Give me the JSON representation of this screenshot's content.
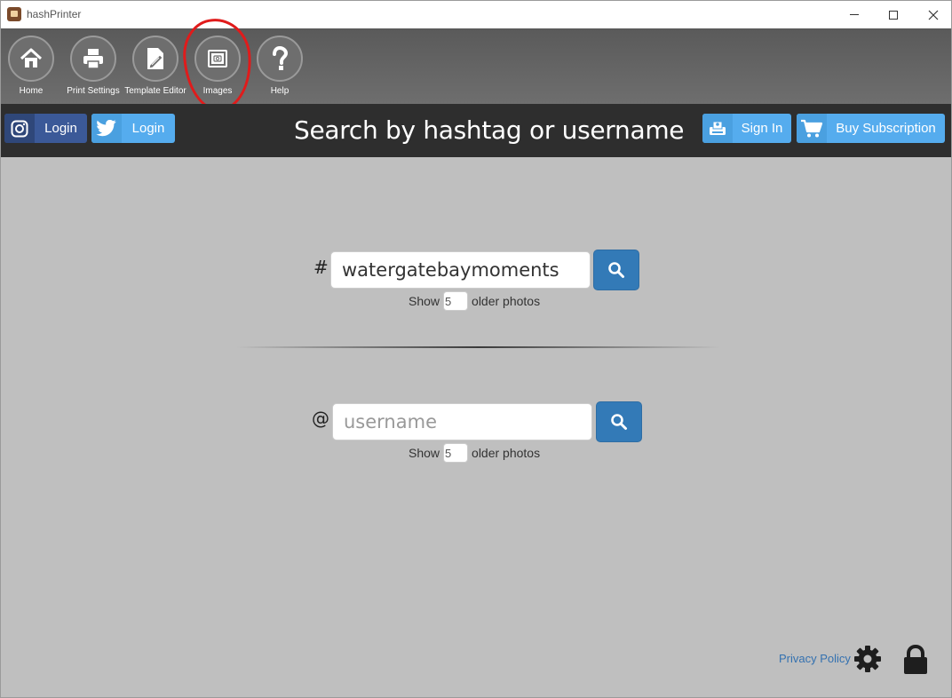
{
  "window": {
    "title": "hashPrinter"
  },
  "toolbar": {
    "items": [
      {
        "label": "Home",
        "icon": "home-icon"
      },
      {
        "label": "Print Settings",
        "icon": "printer-icon"
      },
      {
        "label": "Template Editor",
        "icon": "template-edit-icon"
      },
      {
        "label": "Images",
        "icon": "images-icon"
      },
      {
        "label": "Help",
        "icon": "question-icon"
      }
    ]
  },
  "header": {
    "instagram_login_label": "Login",
    "twitter_login_label": "Login",
    "title": "Search by hashtag or username",
    "sign_in_label": "Sign In",
    "buy_subscription_label": "Buy Subscription"
  },
  "hashtag_search": {
    "prefix": "#",
    "value": "watergatebaymoments",
    "show_label": "Show",
    "older_count": "5",
    "older_label": "older photos"
  },
  "username_search": {
    "prefix": "@",
    "placeholder": "username",
    "value": "",
    "show_label": "Show",
    "older_count": "5",
    "older_label": "older photos"
  },
  "footer": {
    "privacy_label": "Privacy Policy"
  },
  "colors": {
    "toolbar_bg": "#666666",
    "header_bg": "#2e2e2e",
    "content_bg": "#bfbfbf",
    "instagram": "#3b5998",
    "twitter": "#55acee",
    "search_button": "#337ab7",
    "annotation": "#e01b1b"
  }
}
